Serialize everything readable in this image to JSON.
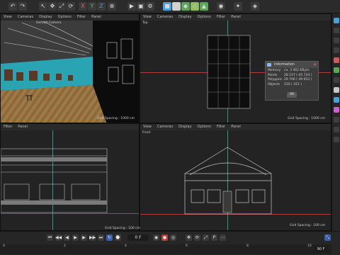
{
  "toolbar": {
    "icons": [
      {
        "name": "undo-icon",
        "glyph": "↶"
      },
      {
        "name": "redo-icon",
        "glyph": "↷"
      },
      {
        "name": "select-icon",
        "glyph": "↖"
      },
      {
        "name": "move-icon",
        "glyph": "✥"
      },
      {
        "name": "scale-icon",
        "glyph": "⤢"
      },
      {
        "name": "rotate-icon",
        "glyph": "⟳"
      },
      {
        "name": "x-axis-label",
        "glyph": "X"
      },
      {
        "name": "y-axis-label",
        "glyph": "Y"
      },
      {
        "name": "z-axis-label",
        "glyph": "Z"
      },
      {
        "name": "world-icon",
        "glyph": "⊕"
      },
      {
        "name": "render-view-icon",
        "glyph": "▶"
      },
      {
        "name": "render-region-icon",
        "glyph": "▣"
      },
      {
        "name": "render-settings-icon",
        "glyph": "⚙"
      },
      {
        "name": "cube-icon",
        "glyph": "■"
      },
      {
        "name": "spline-icon",
        "glyph": "∿"
      },
      {
        "name": "generator-icon",
        "glyph": "◆"
      },
      {
        "name": "deformer-icon",
        "glyph": "◇"
      },
      {
        "name": "environment-icon",
        "glyph": "▲"
      },
      {
        "name": "camera-icon",
        "glyph": "◉"
      },
      {
        "name": "light-icon",
        "glyph": "✦"
      },
      {
        "name": "tag-icon",
        "glyph": "◈"
      }
    ]
  },
  "viewports": {
    "perspective": {
      "menu": [
        "View",
        "Cameras",
        "Display",
        "Options",
        "Filter",
        "Panel"
      ],
      "label": "Default Camera",
      "grid": "Grid Spacing : 1000 cm"
    },
    "top": {
      "menu": [
        "View",
        "Cameras",
        "Display",
        "Options",
        "Filter",
        "Panel"
      ],
      "label": "Top",
      "grid": "Grid Spacing : 1000 cm"
    },
    "right": {
      "menu": [
        "Filter",
        "Panel"
      ],
      "label": "",
      "grid": ""
    },
    "front": {
      "menu": [
        "View",
        "Cameras",
        "Display",
        "Options",
        "Filter",
        "Panel"
      ],
      "label": "Front",
      "grid": "Grid Spacing : 100 cm"
    },
    "bottomleft_grid": "Grid Spacing : 100 cm"
  },
  "dialog": {
    "title": "Information",
    "rows": [
      {
        "label": "Memory",
        "value": "ca. 3 462 KByte"
      },
      {
        "label": "Points",
        "value": "28 237 (-45 724 )"
      },
      {
        "label": "Polygons",
        "value": "29 706 ( 49 653 )"
      },
      {
        "label": "Objects",
        "value": "210 ( 411 )"
      }
    ],
    "ok_label": "OK"
  },
  "timeline": {
    "frame_field": "0 F",
    "end_field": "90 F",
    "ruler_ticks": [
      "0",
      "2",
      "4",
      "6",
      "8",
      "10"
    ],
    "right_value": "90 F"
  },
  "colors": {
    "accent": "#2e9a8e",
    "axis_red": "#b53b3b",
    "sky": "#2aa3b3"
  }
}
